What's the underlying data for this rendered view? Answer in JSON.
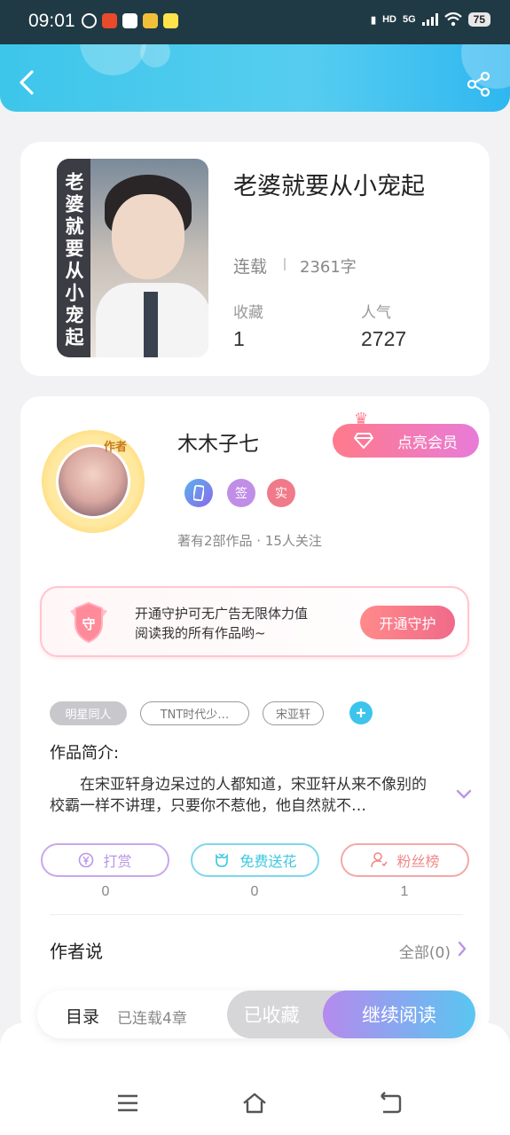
{
  "status_bar": {
    "time": "09:01",
    "network": "5G",
    "hd": "HD",
    "battery": "75"
  },
  "header": {
    "back_icon": "chevron-left-icon",
    "share_icon": "share-icon"
  },
  "book": {
    "title": "老婆就要从小宠起",
    "cover_text": "老婆就要从小宠起",
    "status": "连载",
    "word_count": "2361字",
    "favorites_label": "收藏",
    "favorites_value": "1",
    "popularity_label": "人气",
    "popularity_value": "2727"
  },
  "author": {
    "name": "木木子七",
    "avatar_badge": "作者",
    "vip_button": "点亮会员",
    "badges": [
      {
        "label": "",
        "icon": "phone-icon",
        "color": "#5b8de8"
      },
      {
        "label": "签",
        "color": "#c08ee6"
      },
      {
        "label": "实",
        "color": "#f07a8a"
      }
    ],
    "meta": "著有2部作品 · 15人关注"
  },
  "guard": {
    "icon_text": "守",
    "line1": "开通守护可无广告无限体力值",
    "line2": "阅读我的所有作品哟~",
    "button": "开通守护"
  },
  "tags": [
    "明星同人",
    "TNT时代少…",
    "宋亚轩"
  ],
  "intro": {
    "title": "作品简介:",
    "text": "在宋亚轩身边呆过的人都知道，宋亚轩从来不像别的校霸一样不讲理，只要你不惹他，他自然就不…"
  },
  "actions": [
    {
      "label": "打赏",
      "count": "0",
      "icon": "coin-icon",
      "color": "#b996e6"
    },
    {
      "label": "免费送花",
      "count": "0",
      "icon": "flower-icon",
      "color": "#3cc8e0"
    },
    {
      "label": "粉丝榜",
      "count": "1",
      "icon": "fan-icon",
      "color": "#f08a8a"
    }
  ],
  "author_says": {
    "title": "作者说",
    "all": "全部(0)"
  },
  "bottom_bar": {
    "toc": "目录",
    "toc_sub": "已连载4章",
    "collected": "已收藏",
    "continue": "继续阅读"
  },
  "navbar": {
    "menu_icon": "menu-icon",
    "home_icon": "home-icon",
    "back_icon": "back-icon"
  }
}
